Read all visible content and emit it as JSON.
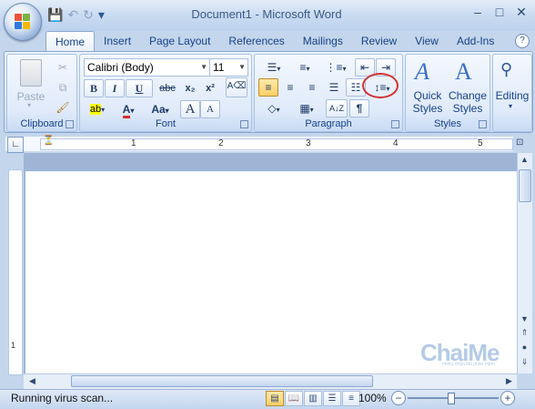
{
  "window": {
    "title": "Document1 - Microsoft Word",
    "controls": {
      "minimize": "–",
      "maximize": "□",
      "close": "✕"
    }
  },
  "quick_access": {
    "save": "💾",
    "undo": "↶",
    "redo": "↻",
    "customize": "▾"
  },
  "tabs": [
    "Home",
    "Insert",
    "Page Layout",
    "References",
    "Mailings",
    "Review",
    "View",
    "Add-Ins"
  ],
  "help": "?",
  "ribbon": {
    "clipboard": {
      "label": "Clipboard",
      "paste": "Paste"
    },
    "font": {
      "label": "Font",
      "family": "Calibri (Body)",
      "size": "11",
      "bold": "B",
      "italic": "I",
      "underline": "U",
      "strike": "abc",
      "subscript": "x₂",
      "superscript": "x²",
      "change_case": "Aa",
      "grow": "A",
      "shrink": "A",
      "highlight": "ab",
      "color": "A"
    },
    "paragraph": {
      "label": "Paragraph",
      "pilcrow": "¶",
      "sort": "A↓Z"
    },
    "styles": {
      "label": "Styles",
      "quick_line1": "Quick",
      "quick_line2": "Styles",
      "change_line1": "Change",
      "change_line2": "Styles"
    },
    "editing": {
      "label": "Editing"
    }
  },
  "ruler": {
    "h_numbers": [
      "1",
      "2",
      "3",
      "4",
      "5"
    ],
    "v_numbers": [
      "1"
    ]
  },
  "status": {
    "text": "Running virus scan...",
    "zoom": "100%"
  },
  "watermark": {
    "main": "ChaiMe",
    "sub": "nhiều nhận xét phần mềm"
  },
  "colors": {
    "accent": "#15428b",
    "highlight_yellow": "#ffff00",
    "font_red": "#d43131",
    "selected": "#ffd067"
  }
}
